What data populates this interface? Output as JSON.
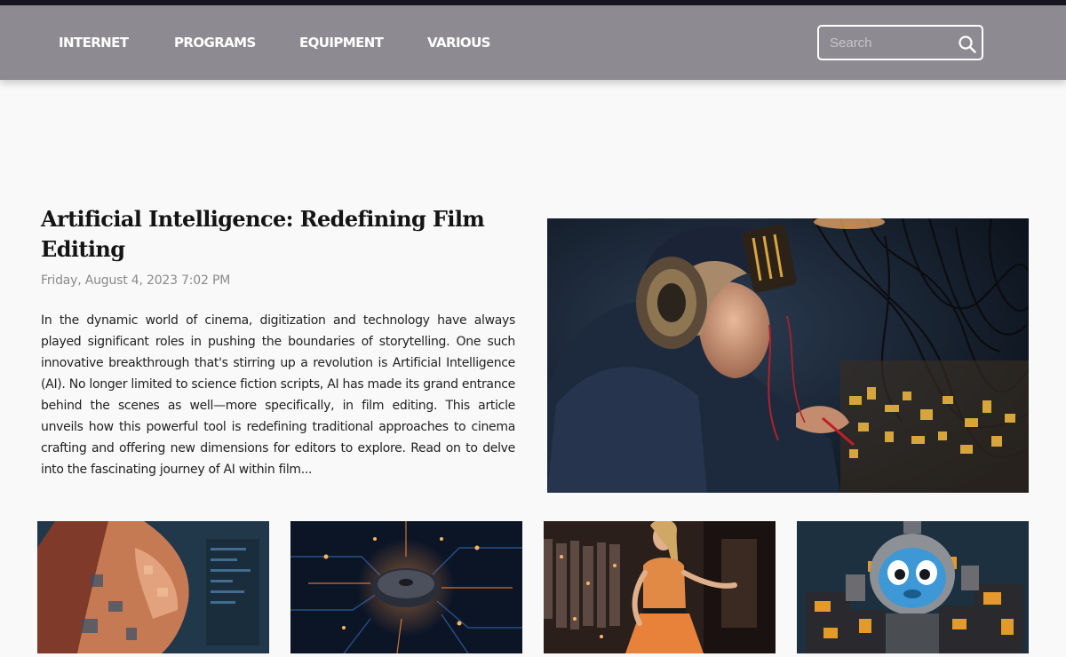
{
  "nav": {
    "items": [
      {
        "label": "INTERNET"
      },
      {
        "label": "PROGRAMS"
      },
      {
        "label": "EQUIPMENT"
      },
      {
        "label": "VARIOUS"
      }
    ],
    "search_placeholder": "Search",
    "search_icon": "search-icon"
  },
  "featured": {
    "title": "Artificial Intelligence: Redefining Film Editing",
    "date": "Friday, August 4, 2023 7:02 PM",
    "excerpt": "In the dynamic world of cinema, digitization and technology have always played significant roles in pushing the boundaries of storytelling. One such innovative breakthrough that's stirring up a revolution is Artificial Intelligence (AI). No longer limited to science fiction scripts, AI has made its grand entrance behind the scenes as well—more specifically, in film editing. This article unveils how this powerful tool is redefining traditional approaches to cinema crafting and offering new dimensions for editors to explore. Read on to delve into the fascinating journey of AI within film...",
    "image_subject": "woman-with-headphones-at-electronics"
  },
  "thumbnails": [
    {
      "subject": "painted-woman-face"
    },
    {
      "subject": "glowing-circuit-board"
    },
    {
      "subject": "woman-in-orange-dress-store"
    },
    {
      "subject": "robot-mascot-with-gadgets"
    }
  ],
  "colors": {
    "navbar": "#8d8b91",
    "top_stripe": "#17151f",
    "background": "#f9f9f9"
  }
}
